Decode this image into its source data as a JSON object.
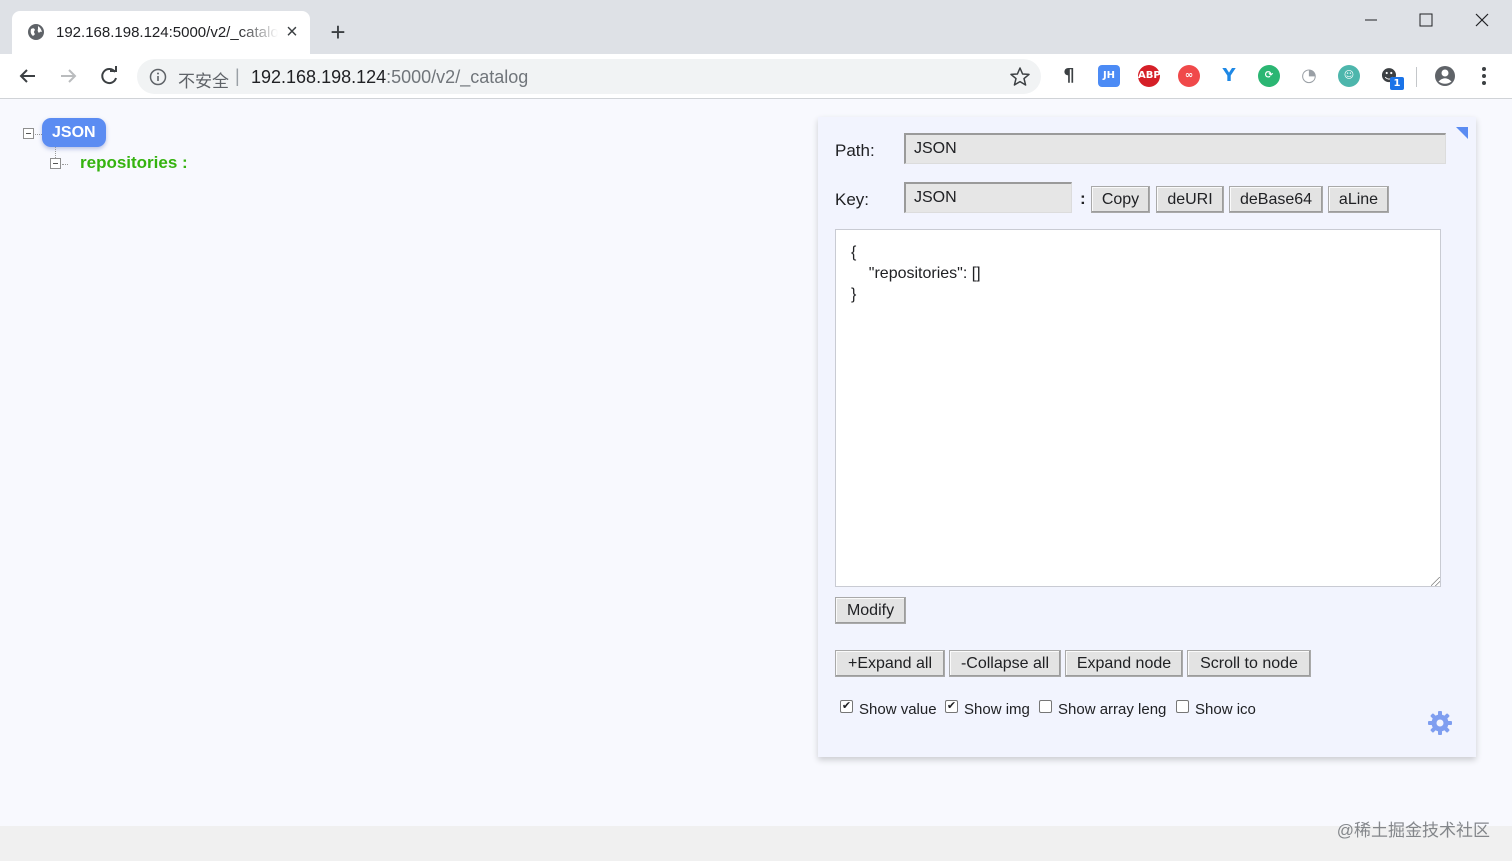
{
  "browser": {
    "tab": {
      "title": "192.168.198.124:5000/v2/_catalog",
      "close": "×"
    },
    "new_tab": "+",
    "address_bar": {
      "security_label": "不安全",
      "url_host": "192.168.198.124",
      "url_rest": ":5000/v2/_catalog"
    },
    "extensions": [
      {
        "name": "pilcrow-extension",
        "text": "¶",
        "color": "#3c4043"
      },
      {
        "name": "jh-extension",
        "text": "JH",
        "color": "#4c8bf5"
      },
      {
        "name": "adblock-plus-extension",
        "text": "ABP",
        "color": "#d51f27"
      },
      {
        "name": "infinity-extension",
        "text": "∞",
        "color": "#f0494a"
      },
      {
        "name": "y-extension",
        "text": "Y",
        "color": "#1e88e5"
      },
      {
        "name": "refresh-extension",
        "text": "⟳",
        "color": "#2bb673"
      },
      {
        "name": "speed-extension",
        "text": "◔",
        "color": "#9aa0a6"
      },
      {
        "name": "avatar-extension",
        "text": "☺",
        "color": "#4db6ac"
      },
      {
        "name": "cat-extension",
        "text": "1",
        "color": "#1a73e8"
      }
    ]
  },
  "tree": {
    "root_label": "JSON",
    "items": [
      {
        "key": "repositories :"
      }
    ]
  },
  "panel": {
    "path_label": "Path:",
    "path_value": "JSON",
    "key_label": "Key:",
    "key_value": "JSON",
    "key_separator": ":",
    "buttons": {
      "copy": "Copy",
      "deuri": "deURI",
      "debase64": "deBase64",
      "aline": "aLine",
      "modify": "Modify"
    },
    "editor_text": "{\n    \"repositories\": []\n}",
    "actions": {
      "expand_all": "+Expand all",
      "collapse_all": "-Collapse all",
      "expand_node": "Expand node",
      "scroll_to_node": "Scroll to node"
    },
    "options": [
      {
        "label": "Show value",
        "checked": true
      },
      {
        "label": "Show img",
        "checked": true
      },
      {
        "label": "Show array leng",
        "checked": false
      },
      {
        "label": "Show ico",
        "checked": false
      }
    ]
  },
  "watermark": "@稀土掘金技术社区",
  "colors": {
    "accent": "#5b8cf2",
    "tree_key": "#35b30f",
    "panel_bg": "#f2f4fe"
  }
}
